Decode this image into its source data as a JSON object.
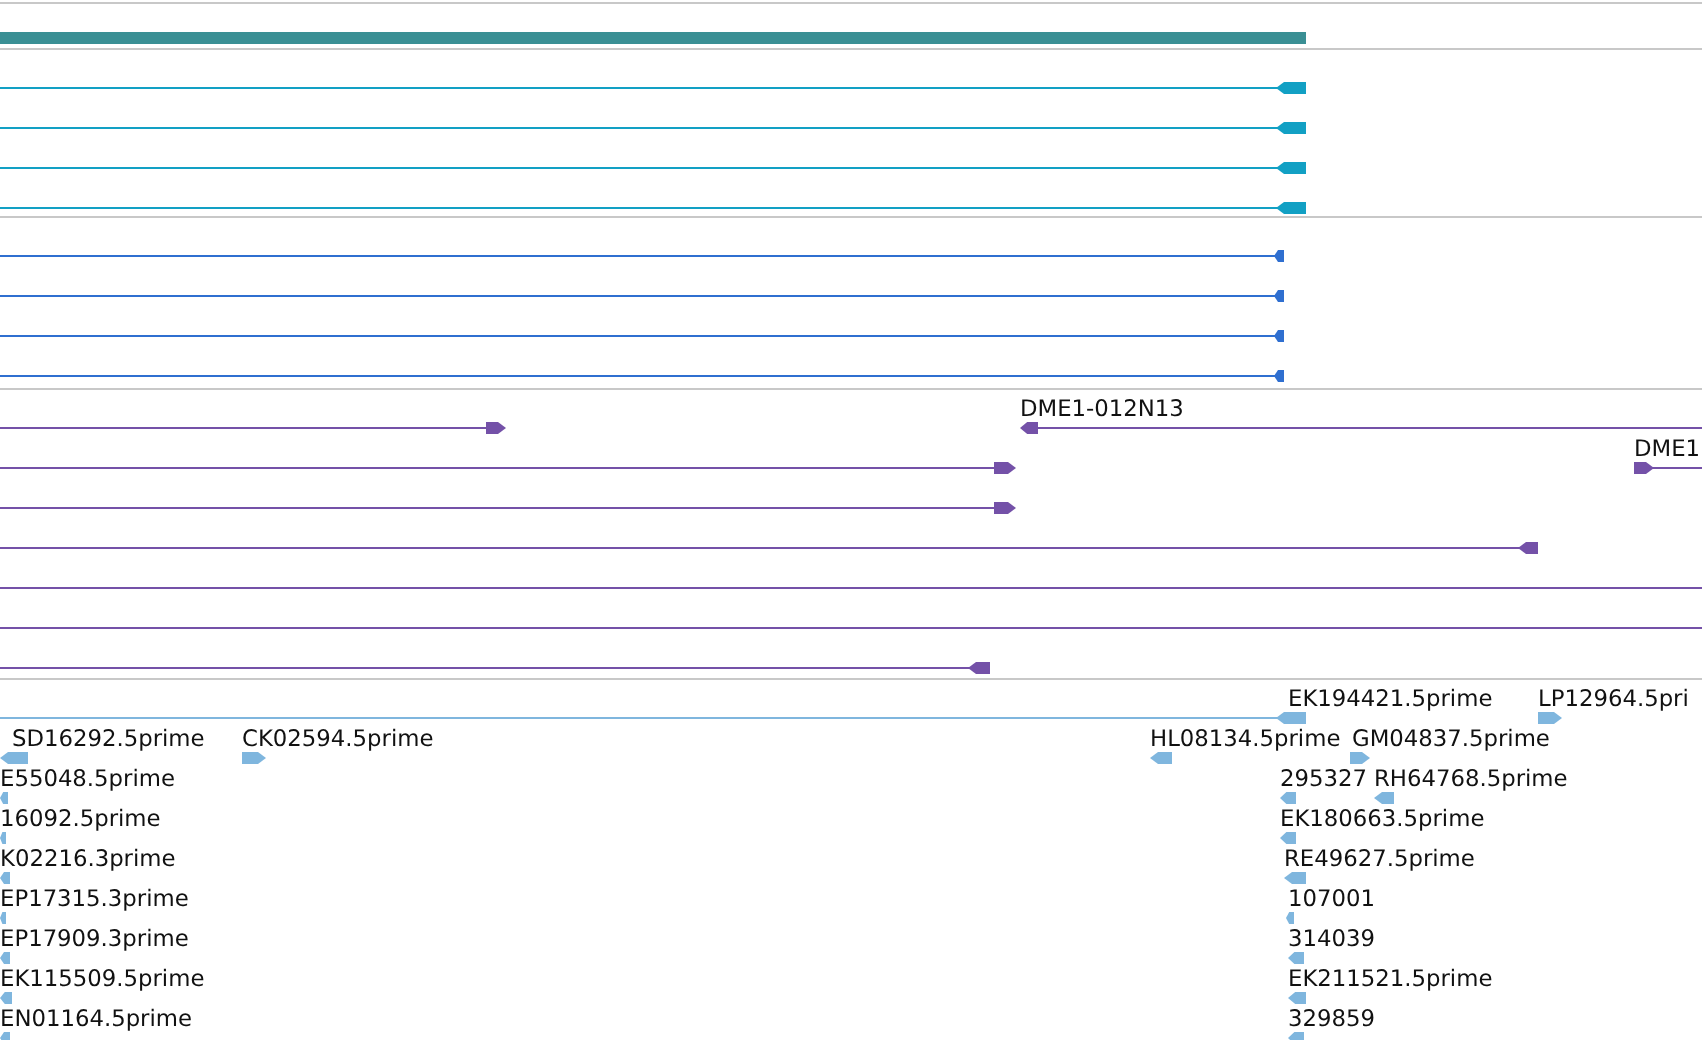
{
  "tracks": [
    {
      "kind": "bar",
      "color": "#3a8f94"
    },
    {
      "kind": "features",
      "color": "#12a0c4",
      "rows": [
        {
          "features": [
            {
              "kind": "arrow",
              "reverse": true
            }
          ]
        },
        {
          "features": [
            {
              "kind": "arrow",
              "reverse": true
            }
          ]
        },
        {
          "features": [
            {
              "kind": "arrow",
              "reverse": true
            }
          ]
        },
        {
          "features": [
            {
              "kind": "arrow",
              "reverse": true
            }
          ]
        }
      ]
    },
    {
      "kind": "features",
      "color": "#2f6fd0",
      "rows": [
        {
          "features": [
            {
              "kind": "arrow",
              "reverse": true
            }
          ]
        },
        {
          "features": [
            {
              "kind": "arrow",
              "reverse": true
            }
          ]
        },
        {
          "features": [
            {
              "kind": "arrow",
              "reverse": true
            }
          ]
        },
        {
          "features": [
            {
              "kind": "arrow",
              "reverse": true
            }
          ]
        }
      ]
    },
    {
      "kind": "features",
      "color": "#7451a8",
      "rows": [
        {
          "features": [
            {
              "kind": "arrow",
              "reverse": false
            },
            {
              "kind": "arrow",
              "reverse": true,
              "label": "DME1-012N13"
            }
          ]
        },
        {
          "features": [
            {
              "kind": "arrow",
              "reverse": false
            },
            {
              "kind": "arrow",
              "reverse": false,
              "label": "DME1"
            }
          ]
        },
        {
          "features": [
            {
              "kind": "arrow",
              "reverse": false
            }
          ]
        },
        {
          "features": [
            {
              "kind": "arrow",
              "reverse": true
            }
          ]
        },
        {
          "features": [
            {
              "kind": "line"
            }
          ]
        },
        {
          "features": [
            {
              "kind": "line"
            }
          ]
        },
        {
          "features": [
            {
              "kind": "arrow",
              "reverse": true
            }
          ]
        }
      ]
    },
    {
      "kind": "features",
      "color": "#7fb6de",
      "rows": [
        {
          "features": [
            {
              "kind": "arrow",
              "reverse": true,
              "label": "EK194421.5prime"
            },
            {
              "kind": "arrow",
              "reverse": false,
              "label": "LP12964.5pri"
            }
          ]
        },
        {
          "features": [
            {
              "kind": "arrow",
              "reverse": true,
              "label": "SD16292.5prime"
            },
            {
              "kind": "arrow",
              "reverse": false,
              "label": "CK02594.5prime"
            },
            {
              "kind": "arrow",
              "reverse": true,
              "label": "HL08134.5prime"
            },
            {
              "kind": "arrow",
              "reverse": false,
              "label": "GM04837.5prime"
            }
          ]
        },
        {
          "features": [
            {
              "kind": "arrow",
              "reverse": true,
              "label": "E55048.5prime"
            },
            {
              "kind": "arrow",
              "reverse": true,
              "label": "295327"
            },
            {
              "kind": "arrow",
              "reverse": true,
              "label": "RH64768.5prime"
            }
          ]
        },
        {
          "features": [
            {
              "kind": "arrow",
              "reverse": true,
              "label": "16092.5prime"
            },
            {
              "kind": "arrow",
              "reverse": true,
              "label": "EK180663.5prime"
            }
          ]
        },
        {
          "features": [
            {
              "kind": "arrow",
              "reverse": true,
              "label": "K02216.3prime"
            },
            {
              "kind": "arrow",
              "reverse": true,
              "label": "RE49627.5prime"
            }
          ]
        },
        {
          "features": [
            {
              "kind": "arrow",
              "reverse": true,
              "label": "EP17315.3prime"
            },
            {
              "kind": "arrow",
              "reverse": true,
              "label": "107001"
            }
          ]
        },
        {
          "features": [
            {
              "kind": "arrow",
              "reverse": true,
              "label": "EP17909.3prime"
            },
            {
              "kind": "arrow",
              "reverse": true,
              "label": "314039"
            }
          ]
        },
        {
          "features": [
            {
              "kind": "arrow",
              "reverse": true,
              "label": "EK115509.5prime"
            },
            {
              "kind": "arrow",
              "reverse": true,
              "label": "EK211521.5prime"
            }
          ]
        },
        {
          "features": [
            {
              "kind": "arrow",
              "reverse": true,
              "label": "EN01164.5prime"
            },
            {
              "kind": "arrow",
              "reverse": true,
              "label": "329859"
            }
          ]
        }
      ]
    }
  ]
}
